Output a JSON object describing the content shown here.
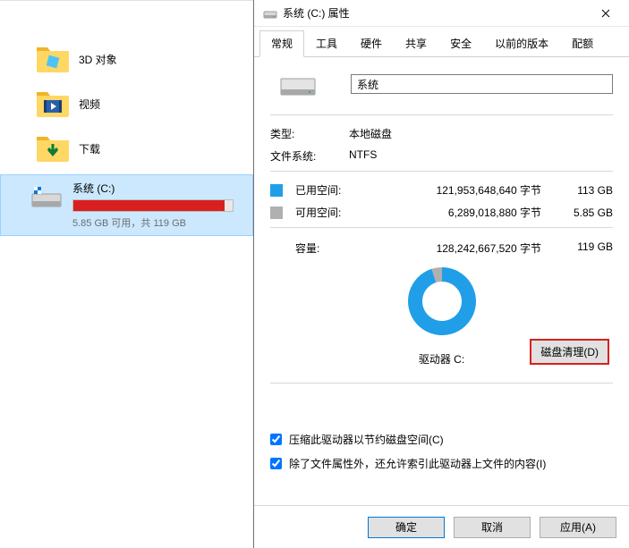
{
  "explorer": {
    "items": [
      {
        "label": "3D 对象"
      },
      {
        "label": "视频"
      },
      {
        "label": "下载"
      }
    ],
    "drive": {
      "label": "系统 (C:)",
      "subtext": "5.85 GB 可用，共 119 GB",
      "used_pct": 95
    }
  },
  "dialog": {
    "title": "系统 (C:) 属性",
    "tabs": [
      "常规",
      "工具",
      "硬件",
      "共享",
      "安全",
      "以前的版本",
      "配额"
    ],
    "name_value": "系统",
    "type_label": "类型:",
    "type_value": "本地磁盘",
    "fs_label": "文件系统:",
    "fs_value": "NTFS",
    "used_label": "已用空间:",
    "used_bytes": "121,953,648,640 字节",
    "used_gb": "113 GB",
    "free_label": "可用空间:",
    "free_bytes": "6,289,018,880 字节",
    "free_gb": "5.85 GB",
    "capacity_label": "容量:",
    "capacity_bytes": "128,242,667,520 字节",
    "capacity_gb": "119 GB",
    "drive_letter": "驱动器 C:",
    "cleanup_btn": "磁盘清理(D)",
    "check1": "压缩此驱动器以节约磁盘空间(C)",
    "check2": "除了文件属性外，还允许索引此驱动器上文件的内容(I)",
    "ok": "确定",
    "cancel": "取消",
    "apply": "应用(A)"
  },
  "chart_data": {
    "type": "pie",
    "title": "",
    "categories": [
      "已用空间",
      "可用空间"
    ],
    "values": [
      113,
      5.85
    ],
    "colors": [
      "#209fe8",
      "#b0b0b0"
    ]
  }
}
